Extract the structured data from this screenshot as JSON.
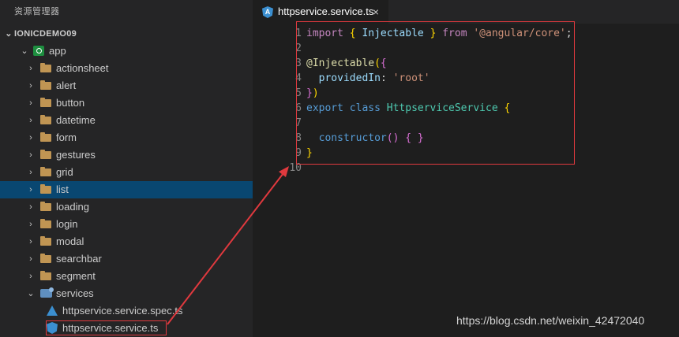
{
  "explorer": {
    "header": "资源管理器",
    "root_label": "IONICDEMO09",
    "items": [
      {
        "label": "app",
        "kind": "app-folder"
      },
      {
        "label": "actionsheet",
        "kind": "folder"
      },
      {
        "label": "alert",
        "kind": "folder"
      },
      {
        "label": "button",
        "kind": "folder"
      },
      {
        "label": "datetime",
        "kind": "folder"
      },
      {
        "label": "form",
        "kind": "folder"
      },
      {
        "label": "gestures",
        "kind": "folder"
      },
      {
        "label": "grid",
        "kind": "folder"
      },
      {
        "label": "list",
        "kind": "folder",
        "selected": true
      },
      {
        "label": "loading",
        "kind": "folder"
      },
      {
        "label": "login",
        "kind": "folder"
      },
      {
        "label": "modal",
        "kind": "folder"
      },
      {
        "label": "searchbar",
        "kind": "folder"
      },
      {
        "label": "segment",
        "kind": "folder"
      },
      {
        "label": "services",
        "kind": "services-folder"
      },
      {
        "label": "httpservice.service.spec.ts",
        "kind": "spec-file"
      },
      {
        "label": "httpservice.service.ts",
        "kind": "angular-file"
      }
    ]
  },
  "tab": {
    "title": "httpservice.service.ts",
    "close_glyph": "×",
    "icon_letter": "A"
  },
  "editor": {
    "line_numbers": [
      "1",
      "2",
      "3",
      "4",
      "5",
      "6",
      "7",
      "8",
      "9",
      "10"
    ],
    "lines": [
      [
        [
          "kw",
          "import"
        ],
        [
          "plain",
          " "
        ],
        [
          "brace",
          "{"
        ],
        [
          "plain",
          " "
        ],
        [
          "prop",
          "Injectable"
        ],
        [
          "plain",
          " "
        ],
        [
          "brace",
          "}"
        ],
        [
          "plain",
          " "
        ],
        [
          "kw",
          "from"
        ],
        [
          "plain",
          " "
        ],
        [
          "str",
          "'@angular/core'"
        ],
        [
          "plain",
          ";"
        ]
      ],
      [],
      [
        [
          "dec",
          "@Injectable"
        ],
        [
          "brace",
          "("
        ],
        [
          "brace2",
          "{"
        ]
      ],
      [
        [
          "plain",
          "  "
        ],
        [
          "prop",
          "providedIn"
        ],
        [
          "plain",
          ": "
        ],
        [
          "str",
          "'root'"
        ]
      ],
      [
        [
          "brace2",
          "}"
        ],
        [
          "brace",
          ")"
        ]
      ],
      [
        [
          "kw2",
          "export"
        ],
        [
          "plain",
          " "
        ],
        [
          "kw2",
          "class"
        ],
        [
          "plain",
          " "
        ],
        [
          "cls",
          "HttpserviceService"
        ],
        [
          "plain",
          " "
        ],
        [
          "brace",
          "{"
        ]
      ],
      [],
      [
        [
          "plain",
          "  "
        ],
        [
          "kw2",
          "constructor"
        ],
        [
          "brace2",
          "()"
        ],
        [
          "plain",
          " "
        ],
        [
          "brace2",
          "{"
        ],
        [
          "plain",
          " "
        ],
        [
          "brace2",
          "}"
        ]
      ],
      [
        [
          "brace",
          "}"
        ]
      ],
      []
    ]
  },
  "watermark": "https://blog.csdn.net/weixin_42472040",
  "colors": {
    "annotation": "#e0393e",
    "selection": "#094771",
    "folder": "#c09553",
    "angular": "#3b8fd0"
  }
}
